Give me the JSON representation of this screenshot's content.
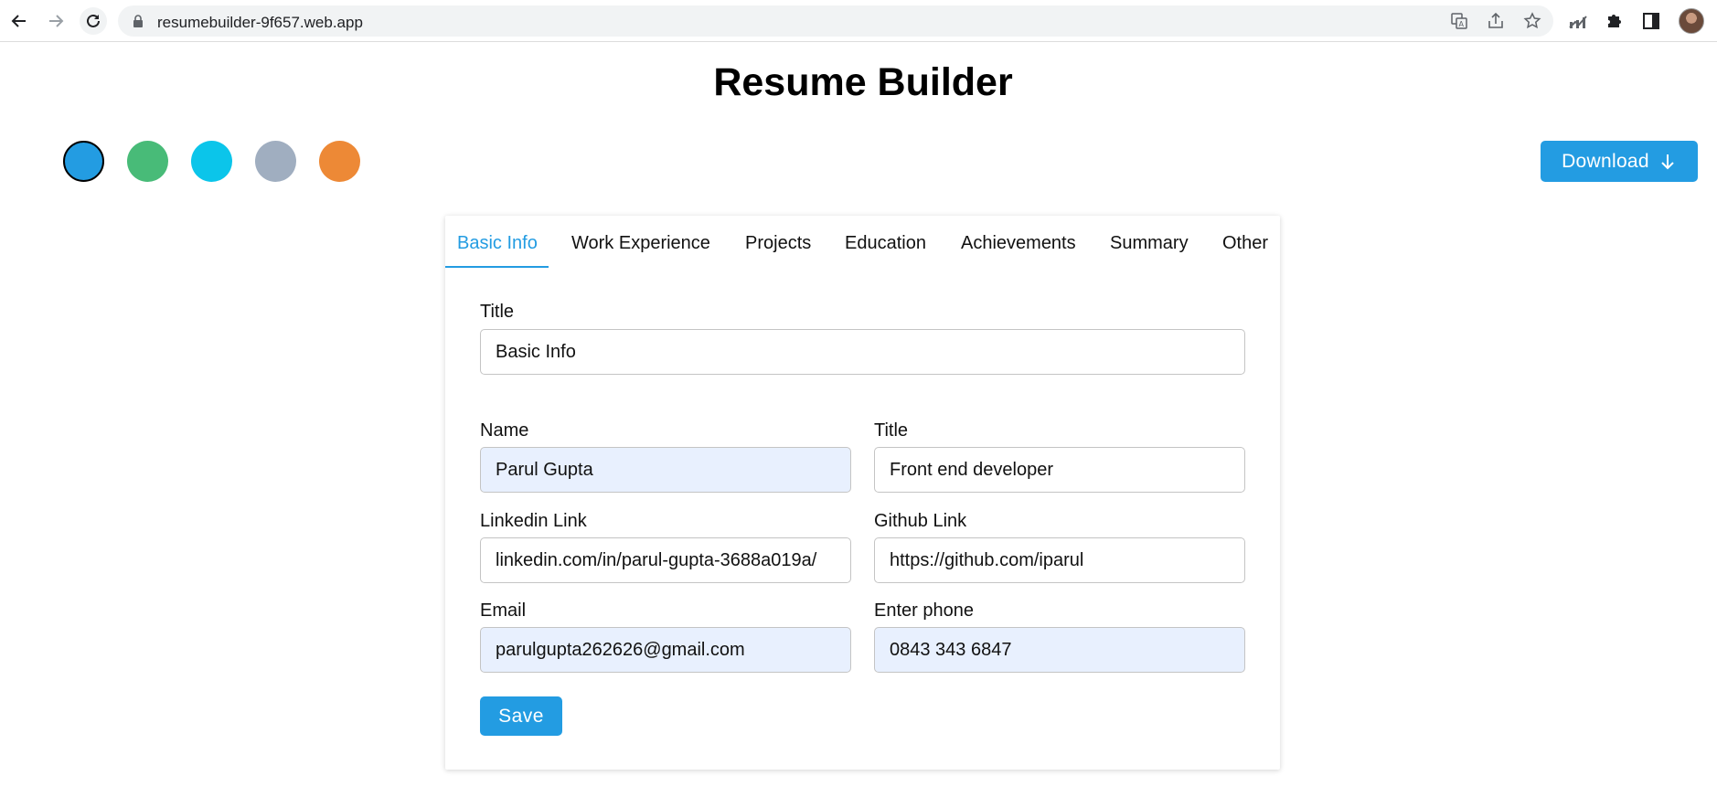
{
  "browser": {
    "url": "resumebuilder-9f657.web.app"
  },
  "app": {
    "title": "Resume Builder",
    "download_label": "Download"
  },
  "colors": {
    "swatches": [
      "#239ce2",
      "#48bb78",
      "#0bc5ea",
      "#a0aec0",
      "#ed8936"
    ],
    "accent": "#239ce2"
  },
  "tabs": [
    {
      "label": "Basic Info",
      "active": true
    },
    {
      "label": "Work Experience"
    },
    {
      "label": "Projects"
    },
    {
      "label": "Education"
    },
    {
      "label": "Achievements"
    },
    {
      "label": "Summary"
    },
    {
      "label": "Other"
    }
  ],
  "form": {
    "section_title_label": "Title",
    "section_title_value": "Basic Info",
    "name_label": "Name",
    "name_value": "Parul Gupta",
    "title_label": "Title",
    "title_value": "Front end developer",
    "linkedin_label": "Linkedin Link",
    "linkedin_value": "linkedin.com/in/parul-gupta-3688a019a/",
    "github_label": "Github Link",
    "github_value": "https://github.com/iparul",
    "email_label": "Email",
    "email_value": "parulgupta262626@gmail.com",
    "phone_label": "Enter phone",
    "phone_value": "0843 343 6847",
    "save_label": "Save"
  }
}
